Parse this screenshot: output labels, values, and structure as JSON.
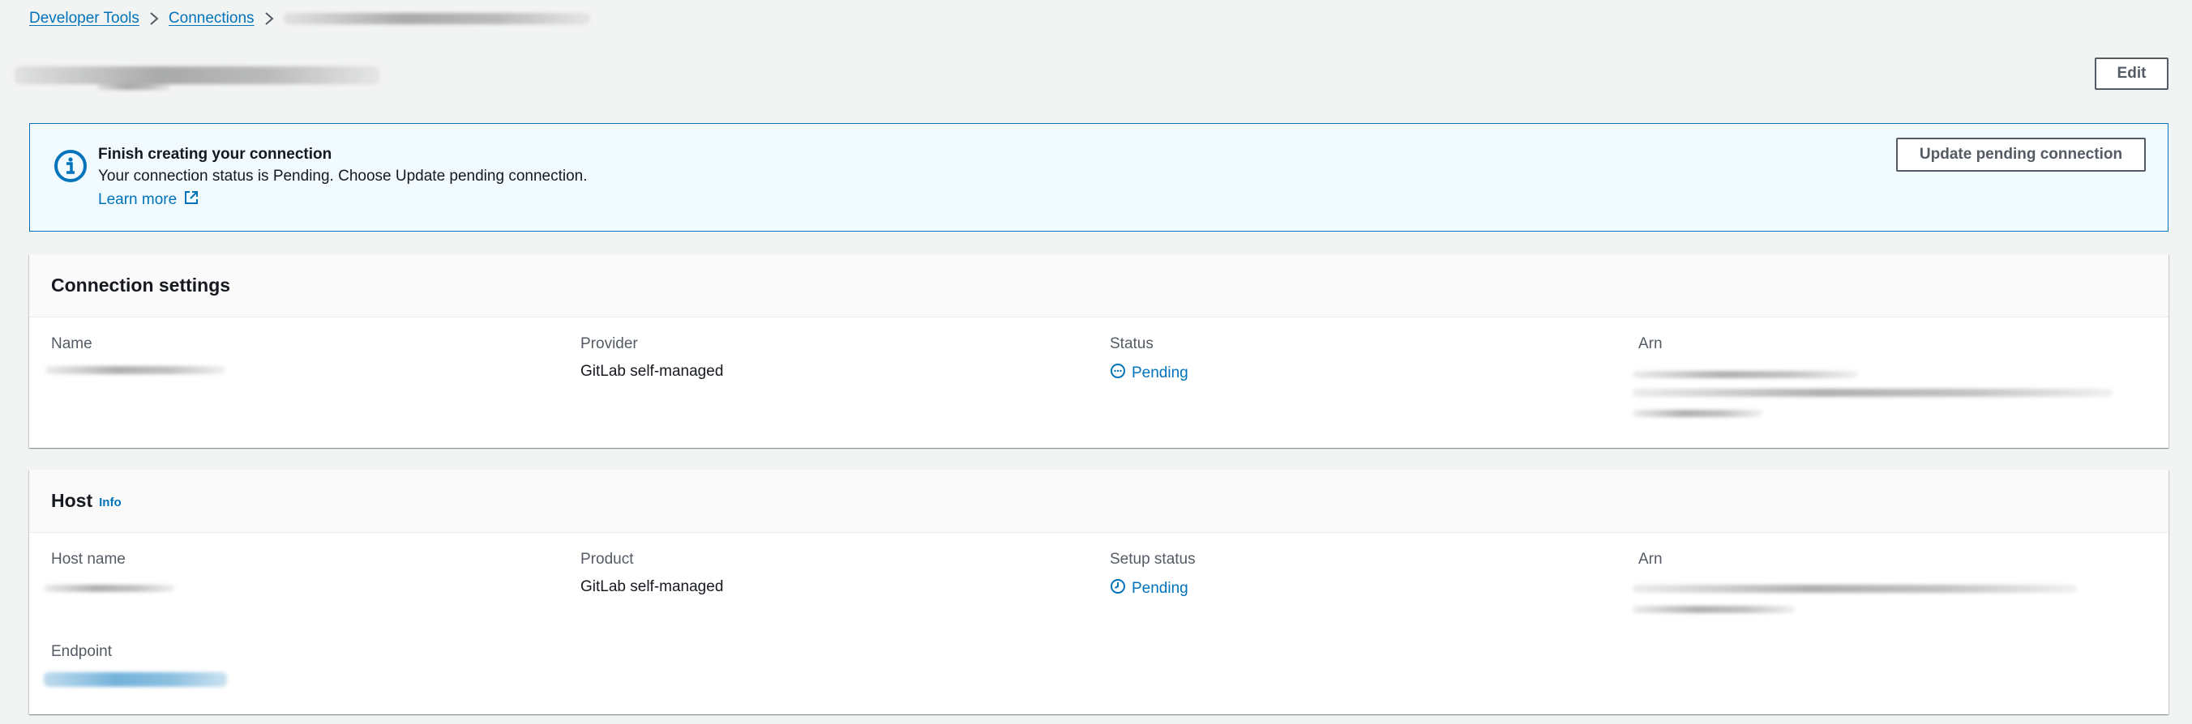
{
  "breadcrumb": {
    "items": [
      "Developer Tools",
      "Connections"
    ]
  },
  "header": {
    "edit_label": "Edit"
  },
  "flash": {
    "title": "Finish creating your connection",
    "message": "Your connection status is Pending. Choose Update pending connection.",
    "learn_more": "Learn more",
    "action_label": "Update pending connection"
  },
  "connection_settings": {
    "title": "Connection settings",
    "labels": {
      "name": "Name",
      "provider": "Provider",
      "status": "Status",
      "arn": "Arn"
    },
    "provider_value": "GitLab self-managed",
    "status_value": "Pending"
  },
  "host": {
    "title": "Host",
    "info_link": "Info",
    "labels": {
      "host_name": "Host name",
      "product": "Product",
      "setup_status": "Setup status",
      "arn": "Arn",
      "endpoint": "Endpoint"
    },
    "product_value": "GitLab self-managed",
    "setup_status_value": "Pending"
  },
  "colors": {
    "link": "#0073bb",
    "background": "#f2f3f3",
    "flash_background": "#f1faff"
  },
  "icons": {
    "breadcrumb_separator": "chevron-right-icon",
    "flash": "info-circle-icon",
    "external_link": "external-link-icon",
    "status_pending": "status-pending-icon",
    "setup_pending": "clock-icon"
  }
}
